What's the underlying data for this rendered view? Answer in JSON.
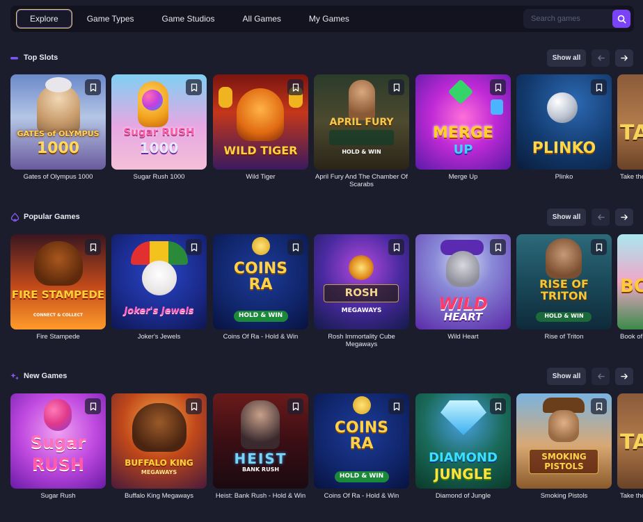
{
  "nav": {
    "tabs": [
      "Explore",
      "Game Types",
      "Game Studios",
      "All Games",
      "My Games"
    ],
    "search_placeholder": "Search games"
  },
  "colors": {
    "accent": "#7a43f5",
    "background": "#1b1d2c",
    "nav_bg": "#12131e",
    "active_border": "#d8d065"
  },
  "sections": [
    {
      "title": "Top Slots",
      "icon": "dash-icon",
      "show_all": "Show all",
      "games": [
        {
          "name": "Gates of Olympus 1000",
          "logo": "GATES of OLYMPUS",
          "sub": "1000"
        },
        {
          "name": "Sugar Rush 1000",
          "logo": "Sugar RUSH",
          "sub": "1000"
        },
        {
          "name": "Wild Tiger",
          "logo": "WILD TIGER",
          "sub": ""
        },
        {
          "name": "April Fury And The Chamber Of Scarabs",
          "logo": "APRIL FURY",
          "sub": "HOLD & WIN"
        },
        {
          "name": "Merge Up",
          "logo": "MERGE",
          "sub": "UP"
        },
        {
          "name": "Plinko",
          "logo": "PLINKO",
          "sub": ""
        },
        {
          "name": "Take the Bank",
          "logo": "TAKE",
          "sub": ""
        }
      ]
    },
    {
      "title": "Popular Games",
      "icon": "spade-icon",
      "show_all": "Show all",
      "games": [
        {
          "name": "Fire Stampede",
          "logo": "FIRE STAMPEDE",
          "sub": "CONNECT & COLLECT"
        },
        {
          "name": "Joker's Jewels",
          "logo": "Joker's Jewels",
          "sub": ""
        },
        {
          "name": "Coins Of Ra - Hold & Win",
          "logo": "COINS RA",
          "sub": "HOLD & WIN"
        },
        {
          "name": "Rosh Immortality Cube Megaways",
          "logo": "ROSH",
          "sub": "MEGAWAYS"
        },
        {
          "name": "Wild Heart",
          "logo": "WILD",
          "sub": "HEART"
        },
        {
          "name": "Rise of Triton",
          "logo": "RISE OF TRITON",
          "sub": "HOLD & WIN"
        },
        {
          "name": "Book of Bamboo",
          "logo": "BO",
          "sub": ""
        }
      ]
    },
    {
      "title": "New Games",
      "icon": "sparkle-icon",
      "show_all": "Show all",
      "games": [
        {
          "name": "Sugar Rush",
          "logo": "Sugar",
          "sub": "RUSH"
        },
        {
          "name": "Buffalo King Megaways",
          "logo": "BUFFALO KING",
          "sub": "MEGAWAYS"
        },
        {
          "name": "Heist: Bank Rush - Hold & Win",
          "logo": "HEIST",
          "sub": "BANK RUSH"
        },
        {
          "name": "Coins Of Ra - Hold & Win",
          "logo": "COINS RA",
          "sub": "HOLD & WIN"
        },
        {
          "name": "Diamond of Jungle",
          "logo": "DIAMOND",
          "sub": "JUNGLE"
        },
        {
          "name": "Smoking Pistols",
          "logo": "SMOKING PISTOLS",
          "sub": ""
        },
        {
          "name": "Take the Bank",
          "logo": "TAKE",
          "sub": ""
        }
      ]
    }
  ]
}
